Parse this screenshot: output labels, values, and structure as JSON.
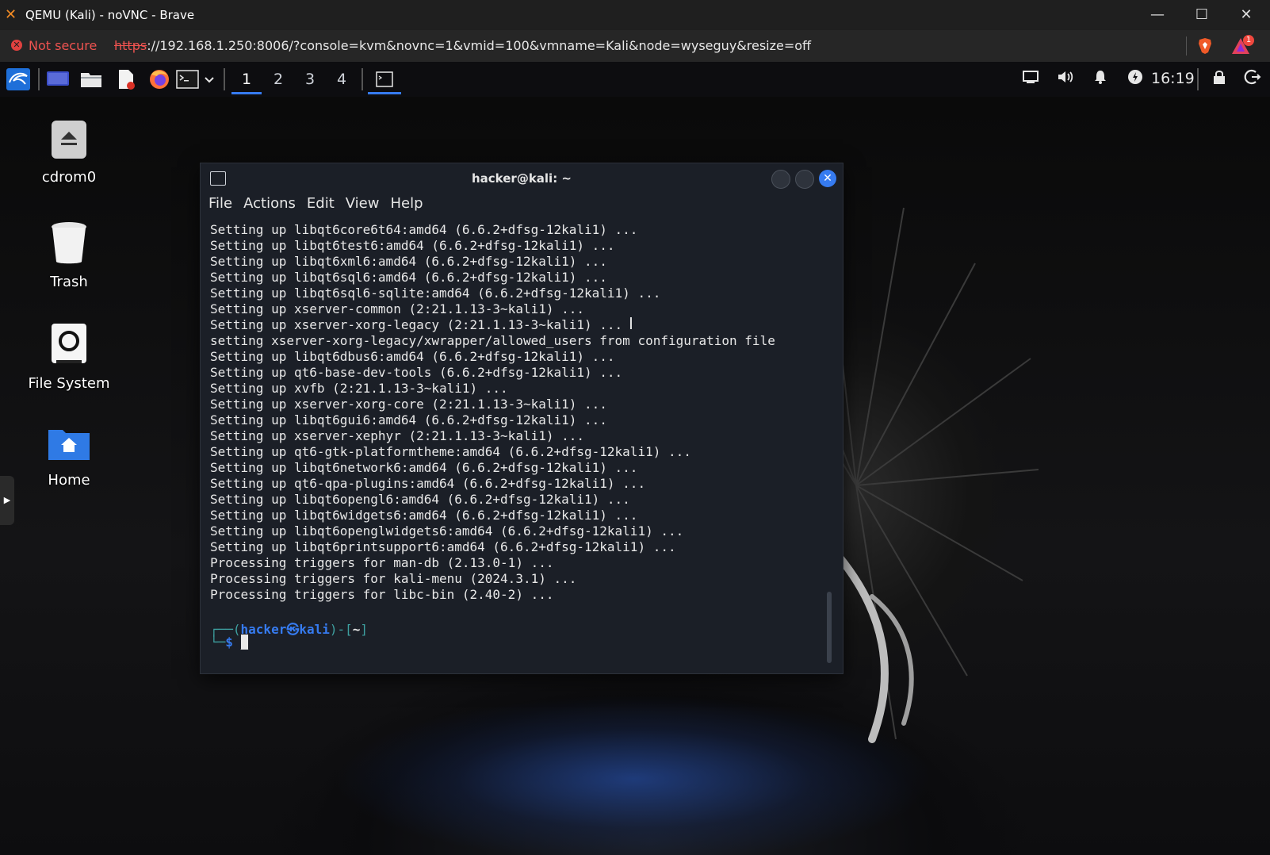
{
  "browser": {
    "window_title": "QEMU (Kali) - noVNC - Brave",
    "not_secure": "Not secure",
    "url_scheme": "https",
    "url_rest": "://192.168.1.250:8006/?console=kvm&novnc=1&vmid=100&vmname=Kali&node=wyseguy&resize=off",
    "rewards_badge": "1",
    "brand_color": "#f08a24"
  },
  "panel": {
    "workspaces": [
      "1",
      "2",
      "3",
      "4"
    ],
    "active_workspace": "1",
    "clock": "16:19",
    "accent": "#367bf0"
  },
  "desktop": {
    "icons": [
      {
        "label": "cdrom0",
        "icon": "drive-eject-icon"
      },
      {
        "label": "Trash",
        "icon": "trash-icon"
      },
      {
        "label": "File System",
        "icon": "drive-icon"
      },
      {
        "label": "Home",
        "icon": "home-folder-icon"
      }
    ]
  },
  "terminal": {
    "title": "hacker@kali: ~",
    "menu": [
      "File",
      "Actions",
      "Edit",
      "View",
      "Help"
    ],
    "lines": [
      "Setting up libqt6core6t64:amd64 (6.6.2+dfsg-12kali1) ...",
      "Setting up libqt6test6:amd64 (6.6.2+dfsg-12kali1) ...",
      "Setting up libqt6xml6:amd64 (6.6.2+dfsg-12kali1) ...",
      "Setting up libqt6sql6:amd64 (6.6.2+dfsg-12kali1) ...",
      "Setting up libqt6sql6-sqlite:amd64 (6.6.2+dfsg-12kali1) ...",
      "Setting up xserver-common (2:21.1.13-3~kali1) ...",
      "Setting up xserver-xorg-legacy (2:21.1.13-3~kali1) ...",
      "setting xserver-xorg-legacy/xwrapper/allowed_users from configuration file",
      "Setting up libqt6dbus6:amd64 (6.6.2+dfsg-12kali1) ...",
      "Setting up qt6-base-dev-tools (6.6.2+dfsg-12kali1) ...",
      "Setting up xvfb (2:21.1.13-3~kali1) ...",
      "Setting up xserver-xorg-core (2:21.1.13-3~kali1) ...",
      "Setting up libqt6gui6:amd64 (6.6.2+dfsg-12kali1) ...",
      "Setting up xserver-xephyr (2:21.1.13-3~kali1) ...",
      "Setting up qt6-gtk-platformtheme:amd64 (6.6.2+dfsg-12kali1) ...",
      "Setting up libqt6network6:amd64 (6.6.2+dfsg-12kali1) ...",
      "Setting up qt6-qpa-plugins:amd64 (6.6.2+dfsg-12kali1) ...",
      "Setting up libqt6opengl6:amd64 (6.6.2+dfsg-12kali1) ...",
      "Setting up libqt6widgets6:amd64 (6.6.2+dfsg-12kali1) ...",
      "Setting up libqt6openglwidgets6:amd64 (6.6.2+dfsg-12kali1) ...",
      "Setting up libqt6printsupport6:amd64 (6.6.2+dfsg-12kali1) ...",
      "Processing triggers for man-db (2.13.0-1) ...",
      "Processing triggers for kali-menu (2024.3.1) ...",
      "Processing triggers for libc-bin (2.40-2) ..."
    ],
    "prompt": {
      "user": "hacker",
      "sep": "㉿",
      "host": "kali",
      "dir": "~",
      "symbol": "$",
      "user_color": "#367bf0"
    }
  }
}
